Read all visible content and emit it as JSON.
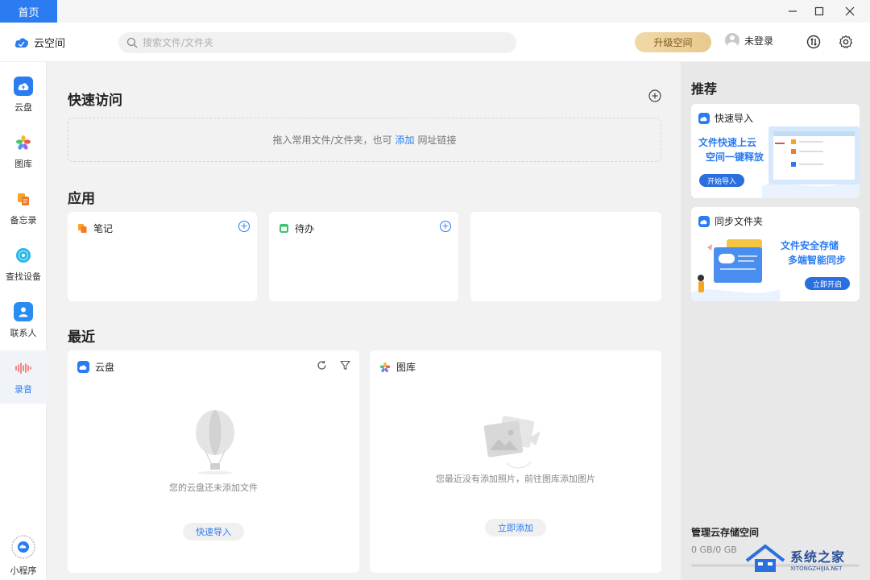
{
  "window": {
    "home_tab": "首页",
    "controls": {
      "minimize": "—",
      "maximize": "☐",
      "close": "✕"
    }
  },
  "header": {
    "app_name": "云空间",
    "search_placeholder": "搜索文件/文件夹",
    "upgrade_label": "升级空间",
    "user_label": "未登录"
  },
  "sidebar": {
    "items": [
      {
        "label": "云盘",
        "icon": "cloud-drive-icon",
        "active": false
      },
      {
        "label": "图库",
        "icon": "gallery-icon",
        "active": false
      },
      {
        "label": "备忘录",
        "icon": "notes-icon",
        "active": false
      },
      {
        "label": "查找设备",
        "icon": "find-device-icon",
        "active": false
      },
      {
        "label": "联系人",
        "icon": "contacts-icon",
        "active": false
      },
      {
        "label": "录音",
        "icon": "recorder-icon",
        "active": true
      }
    ],
    "mini_program": "小程序"
  },
  "quick_access": {
    "title": "快速访问",
    "drop_text_before": "拖入常用文件/文件夹，也可",
    "drop_link": "添加",
    "drop_text_after": "网址链接"
  },
  "apps": {
    "title": "应用",
    "cards": [
      {
        "label": "笔记",
        "icon": "notes-app-icon"
      },
      {
        "label": "待办",
        "icon": "todo-app-icon"
      }
    ]
  },
  "recent": {
    "title": "最近",
    "cloud": {
      "label": "云盘",
      "empty_text": "您的云盘还未添加文件",
      "button": "快速导入"
    },
    "gallery": {
      "label": "图库",
      "empty_text": "您最近没有添加照片，前往图库添加图片",
      "button": "立即添加"
    }
  },
  "recommend": {
    "title": "推荐",
    "cards": [
      {
        "title": "快速导入",
        "line1": "文件快速上云",
        "line2": "空间一键释放",
        "button": "开始导入"
      },
      {
        "title": "同步文件夹",
        "line1": "文件安全存储",
        "line2": "多端智能同步",
        "button": "立即开启"
      }
    ],
    "storage_title": "管理云存储空间",
    "storage_value": "0 GB/0 GB",
    "storage_used_fraction": 0
  },
  "watermark": {
    "title": "系统之家",
    "subtitle": "XITONGZHIJIA.NET"
  },
  "colors": {
    "accent": "#2a7cf0",
    "upgrade_gold": "#e8c98d"
  }
}
